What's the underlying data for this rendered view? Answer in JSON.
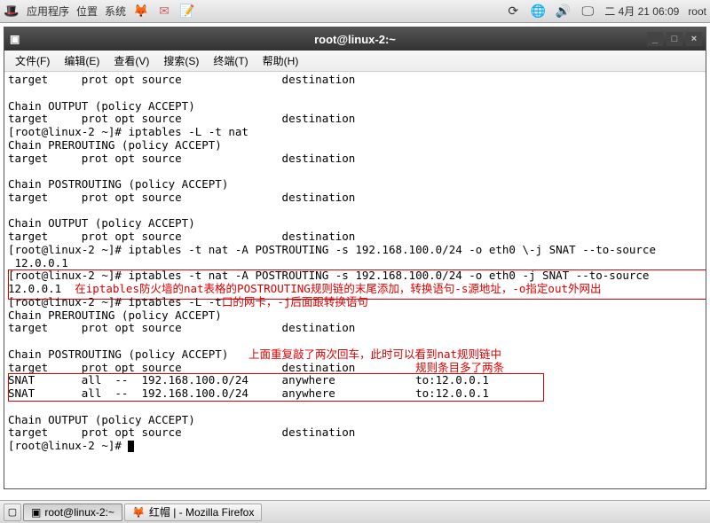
{
  "panel": {
    "apps": "应用程序",
    "places": "位置",
    "system": "系统",
    "date": "二  4月 21 06:09",
    "user": "root"
  },
  "window": {
    "title": "root@linux-2:~"
  },
  "menubar": {
    "file": "文件(F)",
    "edit": "编辑(E)",
    "view": "查看(V)",
    "search": "搜索(S)",
    "terminal": "终端(T)",
    "help": "帮助(H)"
  },
  "annotations": {
    "note1_line1": "在iptables防火墙的nat表格的POSTROUTING规则链的末尾添加，转换语句-s源地址，-o指定out外网出",
    "note1_line2": "口的网卡，-j后面跟转换语句",
    "note2_line1": "上面重复敲了两次回车，此时可以看到nat规则链中",
    "note2_line2": "规则条目多了两条"
  },
  "terminal_lines": [
    "target     prot opt source               destination         ",
    "",
    "Chain OUTPUT (policy ACCEPT)",
    "target     prot opt source               destination         ",
    "[root@linux-2 ~]# iptables -L -t nat",
    "Chain PREROUTING (policy ACCEPT)",
    "target     prot opt source               destination         ",
    "",
    "Chain POSTROUTING (policy ACCEPT)",
    "target     prot opt source               destination         ",
    "",
    "Chain OUTPUT (policy ACCEPT)",
    "target     prot opt source               destination         ",
    "[root@linux-2 ~]# iptables -t nat -A POSTROUTING -s 192.168.100.0/24 -o eth0 \\-j SNAT --to-source",
    " 12.0.0.1",
    "[root@linux-2 ~]# iptables -t nat -A POSTROUTING -s 192.168.100.0/24 -o eth0 -j SNAT --to-source ",
    "12.0.0.1",
    "[root@linux-2 ~]# iptables -L -t nat",
    "Chain PREROUTING (policy ACCEPT)",
    "target     prot opt source               destination         ",
    "",
    "Chain POSTROUTING (policy ACCEPT)",
    "target     prot opt source               destination         ",
    "SNAT       all  --  192.168.100.0/24     anywhere            to:12.0.0.1 ",
    "SNAT       all  --  192.168.100.0/24     anywhere            to:12.0.0.1 ",
    "",
    "Chain OUTPUT (policy ACCEPT)",
    "target     prot opt source               destination         ",
    "[root@linux-2 ~]# "
  ],
  "taskbar": {
    "task1": "root@linux-2:~",
    "task2": "红帽 | - Mozilla Firefox"
  }
}
